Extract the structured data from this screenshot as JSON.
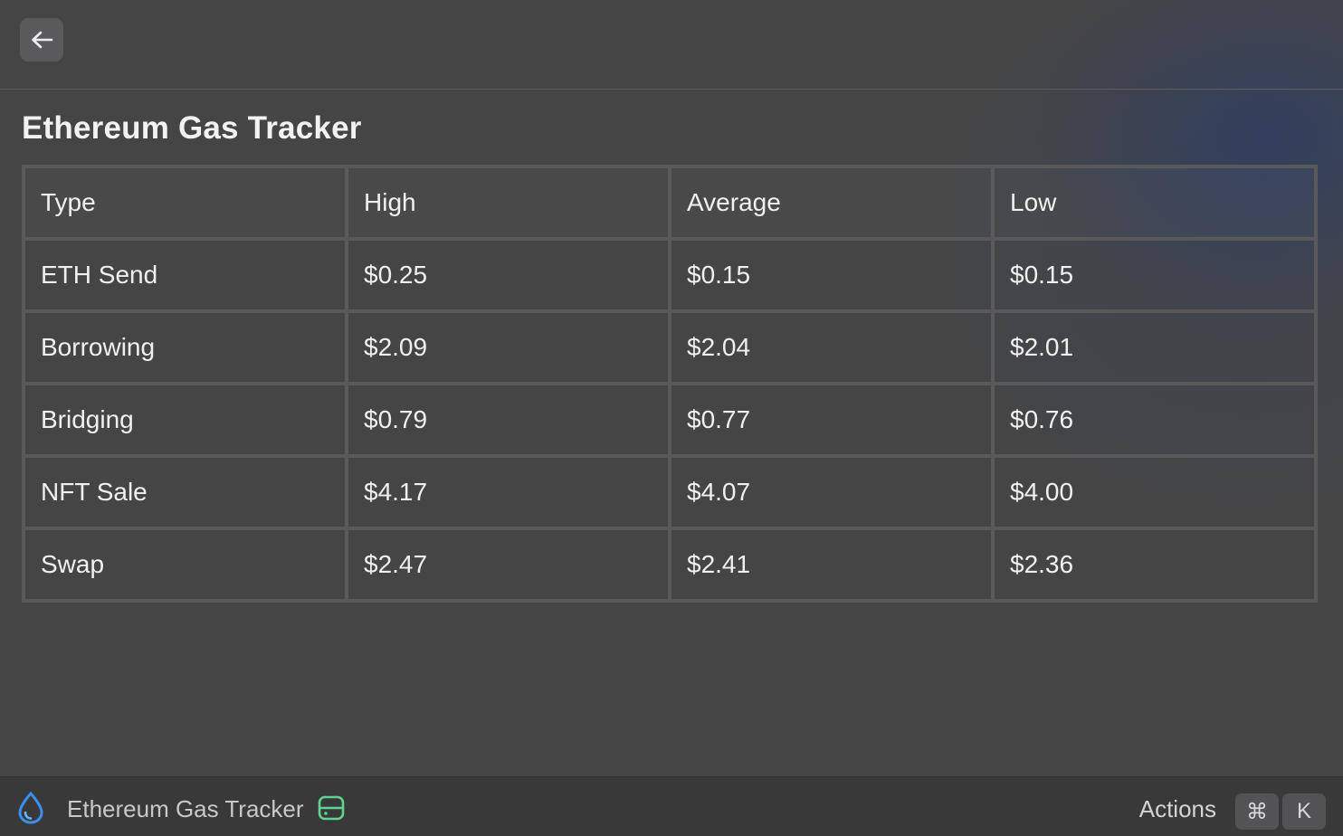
{
  "header": {
    "back_icon": "arrow-left-icon"
  },
  "page": {
    "title": "Ethereum Gas Tracker"
  },
  "table": {
    "columns": [
      "Type",
      "High",
      "Average",
      "Low"
    ],
    "rows": [
      [
        "ETH Send",
        "$0.25",
        "$0.15",
        "$0.15"
      ],
      [
        "Borrowing",
        "$2.09",
        "$2.04",
        "$2.01"
      ],
      [
        "Bridging",
        "$0.79",
        "$0.77",
        "$0.76"
      ],
      [
        "NFT Sale",
        "$4.17",
        "$4.07",
        "$4.00"
      ],
      [
        "Swap",
        "$2.47",
        "$2.41",
        "$2.36"
      ]
    ]
  },
  "footer": {
    "extension_icon": "water-drop-icon",
    "title": "Ethereum Gas Tracker",
    "dev_icon": "hard-drive-icon",
    "actions_label": "Actions",
    "shortcut_keys": [
      "⌘",
      "K"
    ]
  },
  "colors": {
    "background": "#454546",
    "footer_background": "#39393a",
    "drop_icon_blue": "#3b8ff0",
    "dev_icon_green": "#5fd38f"
  }
}
